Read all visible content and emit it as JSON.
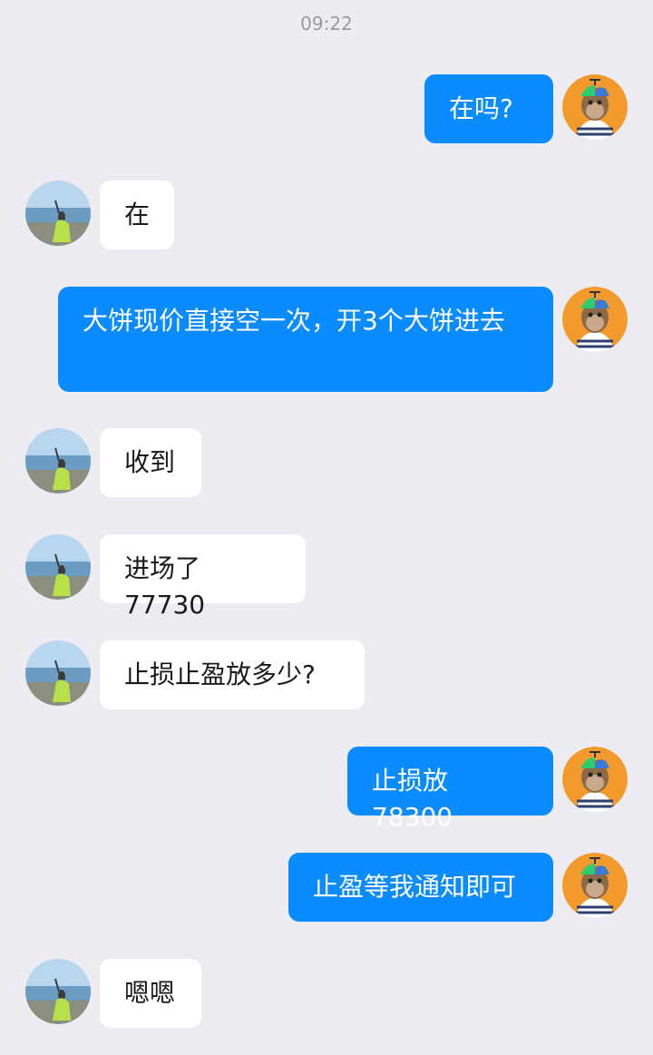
{
  "header": {
    "time": "09:22"
  },
  "messages": [
    {
      "side": "out",
      "text": "在吗?"
    },
    {
      "side": "in",
      "text": "在"
    },
    {
      "side": "out",
      "text": "大饼现价直接空一次，开3个大饼进去"
    },
    {
      "side": "in",
      "text": "收到"
    },
    {
      "side": "in",
      "text": "进场了77730"
    },
    {
      "side": "in",
      "text": "止损止盈放多少?"
    },
    {
      "side": "out",
      "text": "止损放78300"
    },
    {
      "side": "out",
      "text": "止盈等我通知即可"
    },
    {
      "side": "in",
      "text": "嗯嗯"
    }
  ],
  "colors": {
    "background": "#ececf2",
    "outgoing_bubble": "#0a8bff",
    "incoming_bubble": "#ffffff"
  },
  "icons": {
    "self_avatar": "monkey-avatar-icon",
    "contact_avatar": "beach-avatar-icon"
  }
}
